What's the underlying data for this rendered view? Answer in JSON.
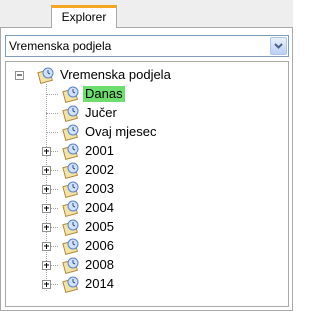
{
  "tabs": [
    {
      "label": "Explorer",
      "active": true
    }
  ],
  "combo": {
    "value": "Vremenska podjela"
  },
  "tree": {
    "root": {
      "label": "Vremenska podjela",
      "expanded": true
    },
    "children": [
      {
        "label": "Danas",
        "selected": true,
        "expandable": false
      },
      {
        "label": "Jučer",
        "expandable": false
      },
      {
        "label": "Ovaj mjesec",
        "expandable": false
      },
      {
        "label": "2001",
        "expandable": true
      },
      {
        "label": "2002",
        "expandable": true
      },
      {
        "label": "2003",
        "expandable": true
      },
      {
        "label": "2004",
        "expandable": true
      },
      {
        "label": "2005",
        "expandable": true
      },
      {
        "label": "2006",
        "expandable": true
      },
      {
        "label": "2008",
        "expandable": true
      },
      {
        "label": "2014",
        "expandable": true
      }
    ]
  },
  "colors": {
    "selection": "#6ddd6d",
    "tab_accent": "#f5a623"
  },
  "icons": {
    "node": "clock-calendar-icon",
    "expand": "plus-icon",
    "collapse": "minus-icon"
  }
}
